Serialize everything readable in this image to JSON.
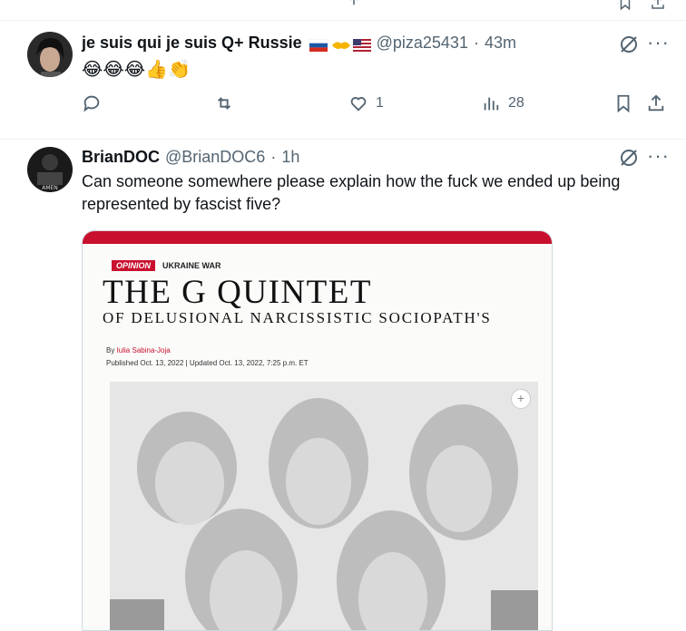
{
  "top_partial": {
    "icons": [
      "share-icon",
      "bookmark-icon"
    ]
  },
  "tweets": [
    {
      "author_name": "je suis qui je suis Q+ Russie",
      "flags": [
        "russia-flag-icon",
        "handshake-icon",
        "usa-flag-icon"
      ],
      "handle": "@piza25431",
      "separator": "·",
      "time": "43m",
      "text": "😂😂😂👍👏",
      "reply_count": "",
      "retweet_count": "",
      "like_count": "1",
      "views_count": "28"
    },
    {
      "author_name": "BrianDOC",
      "handle": "@BrianDOC6",
      "separator": "·",
      "time": "1h",
      "text": "Can someone somewhere please explain how the fuck we ended up being represented by fascist five?",
      "media": {
        "tag_opinion": "OPINION",
        "tag_section": "UKRAINE WAR",
        "headline": "THE G QUINTET",
        "subheadline": "OF DELUSIONAL NARCISSISTIC SOCIOPATH'S",
        "byline_prefix": "By",
        "byline_author": "Iulia Sabina-Joja",
        "dateline": "Published Oct. 13, 2022  |  Updated Oct. 13, 2022, 7:25 p.m. ET",
        "zoom_symbol": "+"
      }
    }
  ],
  "colors": {
    "accent": "#1d9bf0",
    "muted": "#536471",
    "text": "#0f1419",
    "border": "#eff3f4",
    "red": "#c8102e"
  }
}
